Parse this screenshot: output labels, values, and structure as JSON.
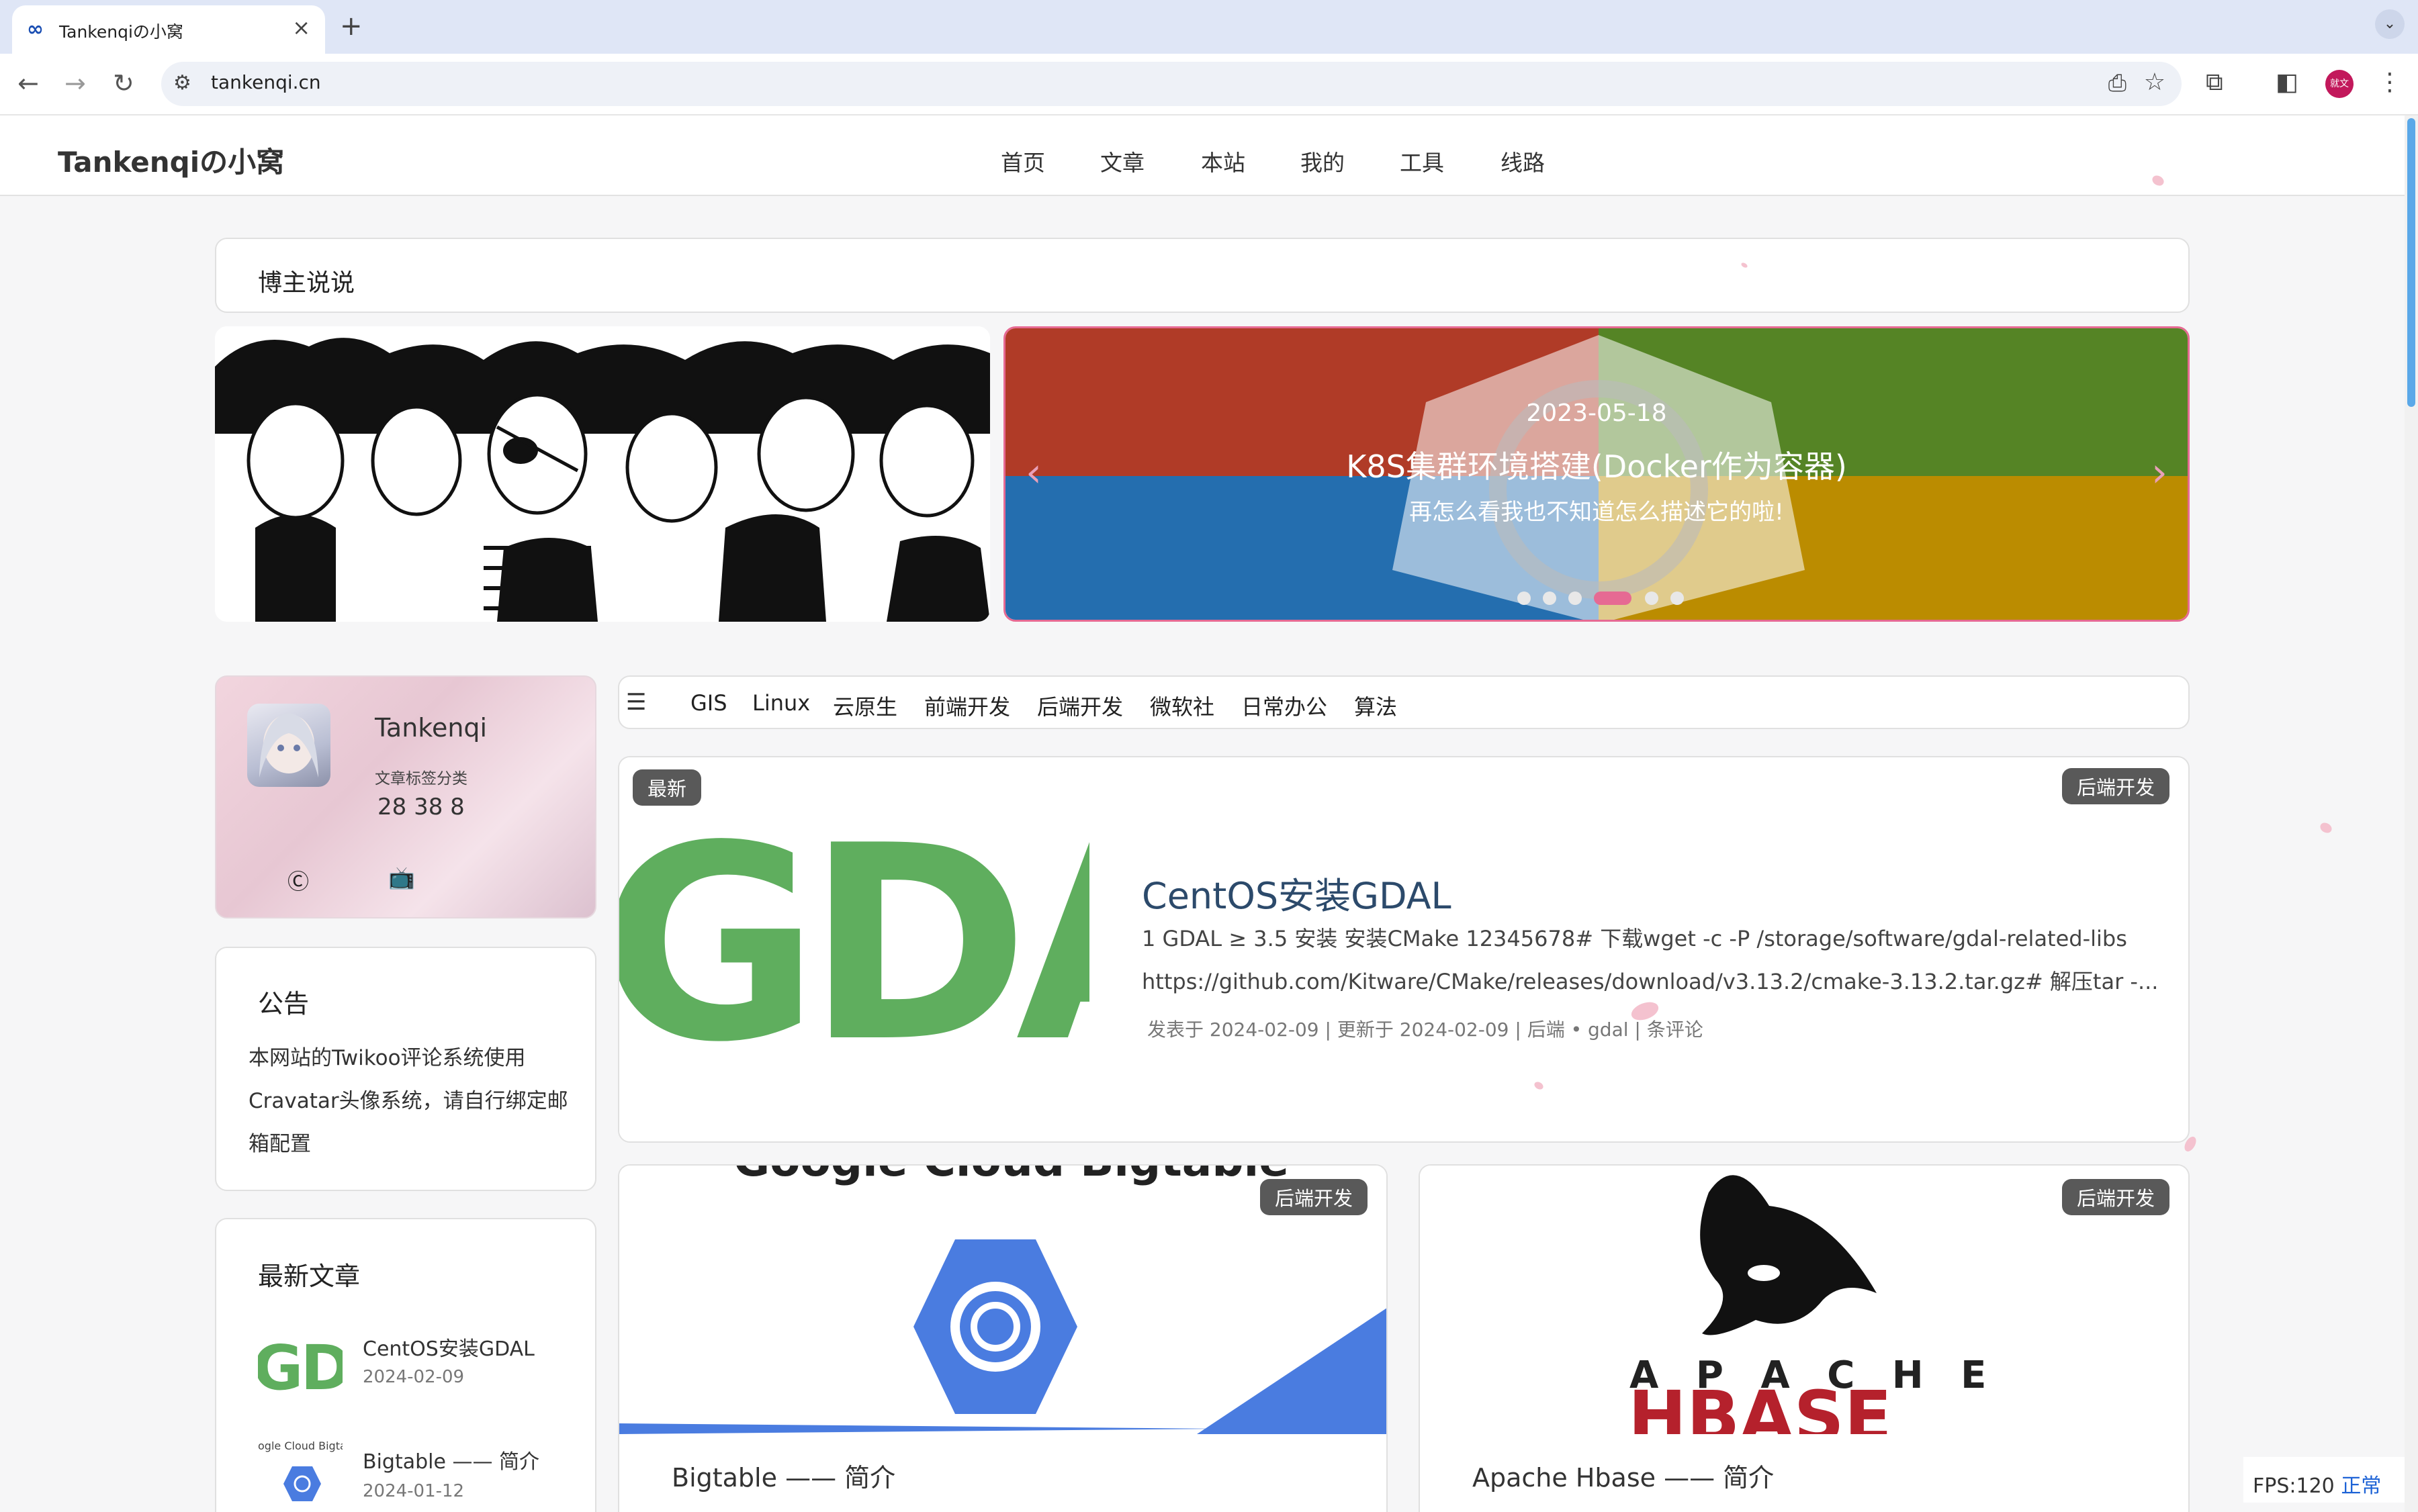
{
  "browser": {
    "tab_title": "Tankenqiの小窝",
    "url": "tankenqi.cn",
    "profile_label": "就文"
  },
  "site": {
    "logo": "Tankenqiの小窝",
    "menu": [
      "首页",
      "文章",
      "本站",
      "我的",
      "工具",
      "线路"
    ]
  },
  "shuoshuo": {
    "title": "博主说说"
  },
  "slider": {
    "date": "2023-05-18",
    "title": "K8S集群环境搭建(Docker作为容器)",
    "desc": "再怎么看我也不知道怎么描述它的啦!"
  },
  "profile": {
    "name": "Tankenqi",
    "stat_label": "文章标签分类",
    "stats": "28 38  8"
  },
  "notice": {
    "title": "公告",
    "body": "本网站的Twikoo评论系统使用Cravatar头像系统，请自行绑定邮箱配置"
  },
  "latest": {
    "title": "最新文章",
    "items": [
      {
        "title": "CentOS安装GDAL",
        "date": "2024-02-09",
        "thumb": "GDAL",
        "icon": "gdal-logo"
      },
      {
        "title": "Bigtable —— 简介",
        "date": "2024-01-12",
        "thumb": "ogle Cloud Bigta",
        "icon": "bigtable-logo"
      }
    ]
  },
  "categories": [
    "GIS",
    "Linux",
    "云原生",
    "前端开发",
    "后端开发",
    "微软社",
    "日常办公",
    "算法"
  ],
  "featured": {
    "badge_new": "最新",
    "category": "后端开发",
    "title": "CentOS安装GDAL",
    "excerpt_1": "1 GDAL ≥ 3.5 安装 安装CMake 12345678# 下载wget -c -P /storage/software/gdal-related-libs",
    "excerpt_2": "https://github.com/Kitware/CMake/releases/download/v3.13.2/cmake-3.13.2.tar.gz# 解压tar -...",
    "meta": "发表于 2024-02-09 | 更新于 2024-02-09 | 后端 • gdal | 条评论",
    "image_text": "GDAL"
  },
  "posts": [
    {
      "category": "后端开发",
      "title": "Bigtable —— 简介",
      "image_text": "Google Cloud Bigtable"
    },
    {
      "category": "后端开发",
      "title": "Apache Hbase —— 简介",
      "image_top": "A P A C H E",
      "image_bottom": "HBASE"
    }
  ],
  "fps": {
    "label": "FPS:120",
    "status": "正常"
  },
  "colors": {
    "accent": "#e66a93",
    "title": "#2c4a6b",
    "badge": "#595959",
    "gdal_green": "#5fae5e",
    "hbase_red": "#b5212c"
  }
}
